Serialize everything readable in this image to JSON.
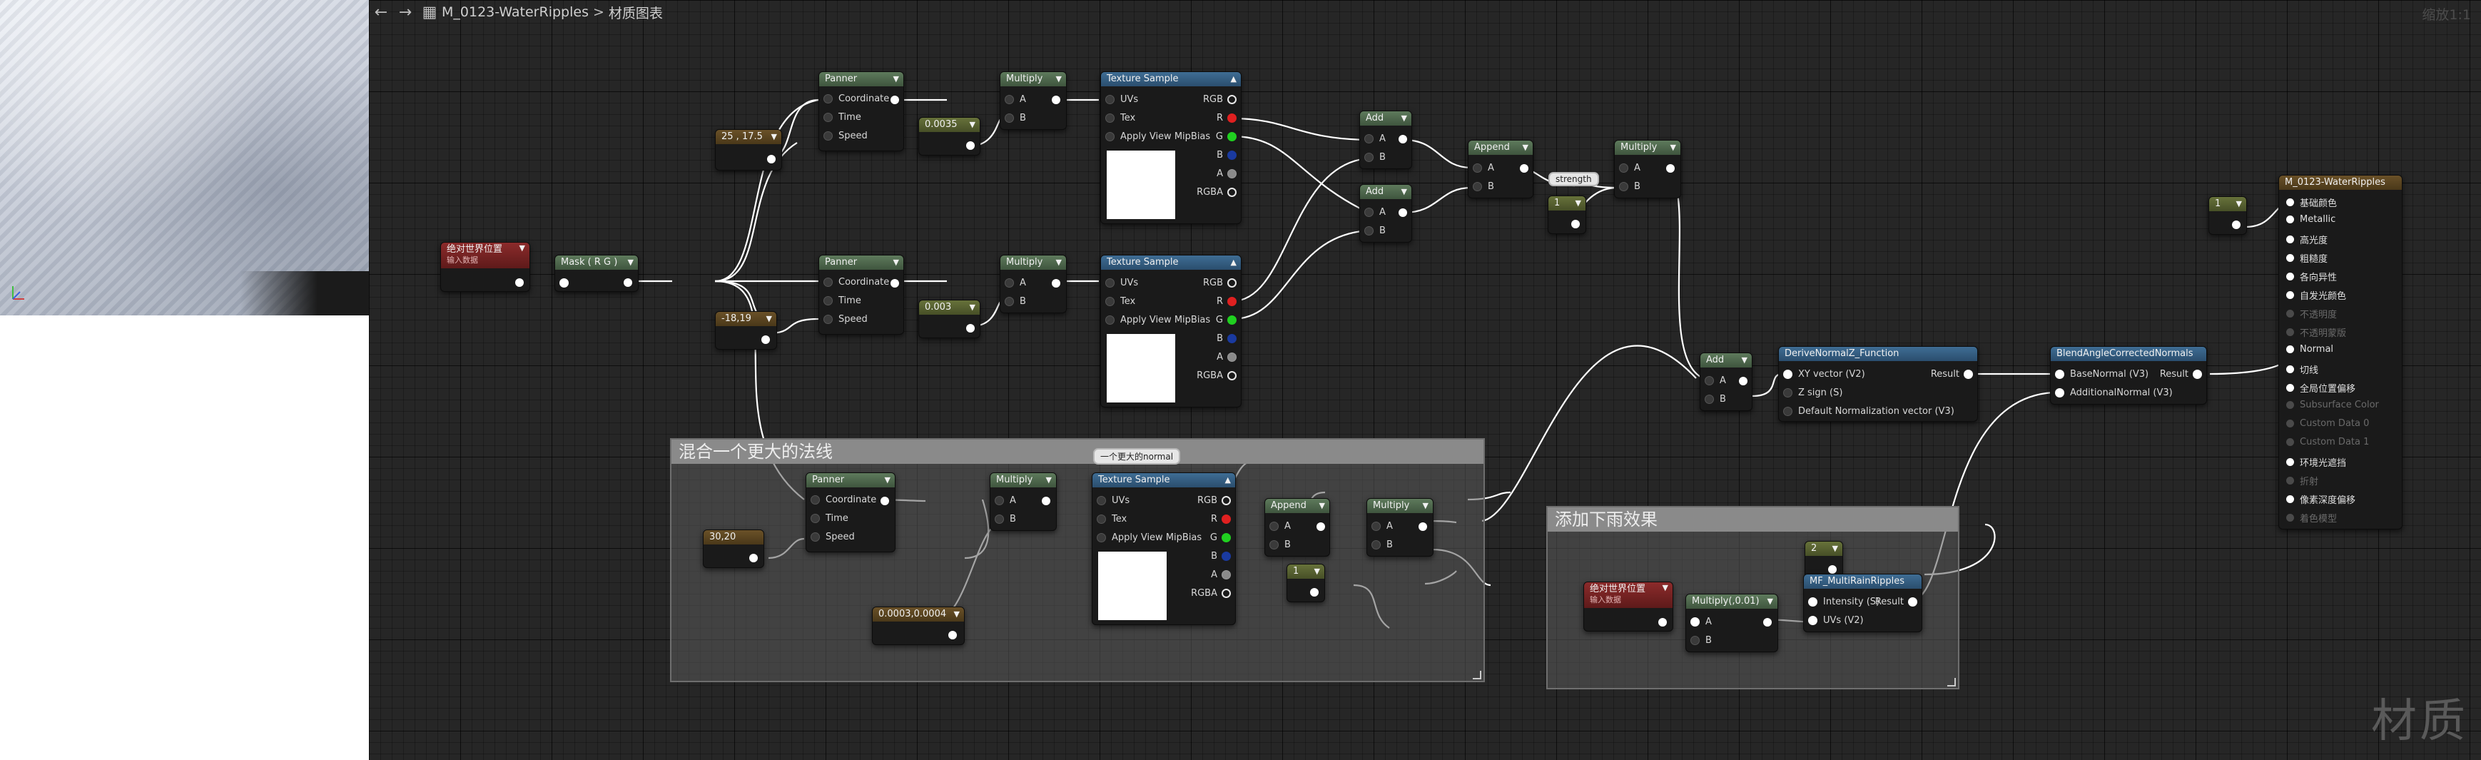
{
  "toolbar": {
    "back_icon": "arrow-left-icon",
    "forward_icon": "arrow-right-icon",
    "graph_icon": "graph-icon",
    "asset_name": "M_0123-WaterRipples",
    "separator": ">",
    "breadcrumb_page": "材质图表",
    "zoom": "缩放1:1"
  },
  "watermark": "材质",
  "comments": {
    "big_normal": "混合一个更大的法线",
    "rain": "添加下雨效果"
  },
  "pill_normal": "一个更大的normal",
  "pill_strength": "strength",
  "nodes": {
    "const2_top": "25 , 17.5",
    "panner_label": "Panner",
    "multiply_label": "Multiply",
    "texsample_label": "Texture Sample",
    "pin_coordinate": "Coordinate",
    "pin_time": "Time",
    "pin_speed": "Speed",
    "pin_a": "A",
    "pin_b": "B",
    "pin_uvs": "UVs",
    "pin_tex": "Tex",
    "pin_mip": "Apply View MipBias",
    "pin_rgb": "RGB",
    "pin_r": "R",
    "pin_g": "G",
    "pin_pb": "B",
    "pin_pa": "A",
    "pin_rgba": "RGBA",
    "const_0035": "0.0035",
    "const_003": "0.003",
    "const_neg": "-18,19",
    "abs_world_pos": "绝对世界位置",
    "abs_world_pos_sub": "输入数据",
    "mask_rg": "Mask ( R G )",
    "add_label": "Add",
    "append_label": "Append",
    "const_1": "1",
    "const_30_20": "30,20",
    "const_0003": "0.0003,0.0004",
    "derive_normal": "DeriveNormalZ_Function",
    "derive_xy": "XY vector (V2)",
    "derive_zsign": "Z sign (S)",
    "derive_default": "Default Normalization vector (V3)",
    "result": "Result",
    "blend_normals": "BlendAngleCorrectedNormals",
    "blend_base": "BaseNormal (V3)",
    "blend_additional": "AdditionalNormal (V3)",
    "rain_ripples": "MF_MultiRainRipples",
    "rain_intensity": "Intensity (S)",
    "rain_uvs": "UVs (V2)",
    "multiply_001": "Multiply(,0.01)",
    "const_2": "2",
    "result_node": "M_0123-WaterRipples"
  },
  "material_inputs": [
    {
      "label": "基础颜色",
      "active": true
    },
    {
      "label": "Metallic",
      "active": true
    },
    {
      "label": "高光度",
      "active": true
    },
    {
      "label": "粗糙度",
      "active": true
    },
    {
      "label": "各向异性",
      "active": true
    },
    {
      "label": "自发光颜色",
      "active": true
    },
    {
      "label": "不透明度",
      "active": false
    },
    {
      "label": "不透明蒙版",
      "active": false
    },
    {
      "label": "Normal",
      "active": true
    },
    {
      "label": "切线",
      "active": true
    },
    {
      "label": "全局位置偏移",
      "active": true
    },
    {
      "label": "Subsurface Color",
      "active": false
    },
    {
      "label": "Custom Data 0",
      "active": false
    },
    {
      "label": "Custom Data 1",
      "active": false
    },
    {
      "label": "环境光遮挡",
      "active": true
    },
    {
      "label": "折射",
      "active": false
    },
    {
      "label": "像素深度偏移",
      "active": true
    },
    {
      "label": "着色模型",
      "active": false
    }
  ]
}
